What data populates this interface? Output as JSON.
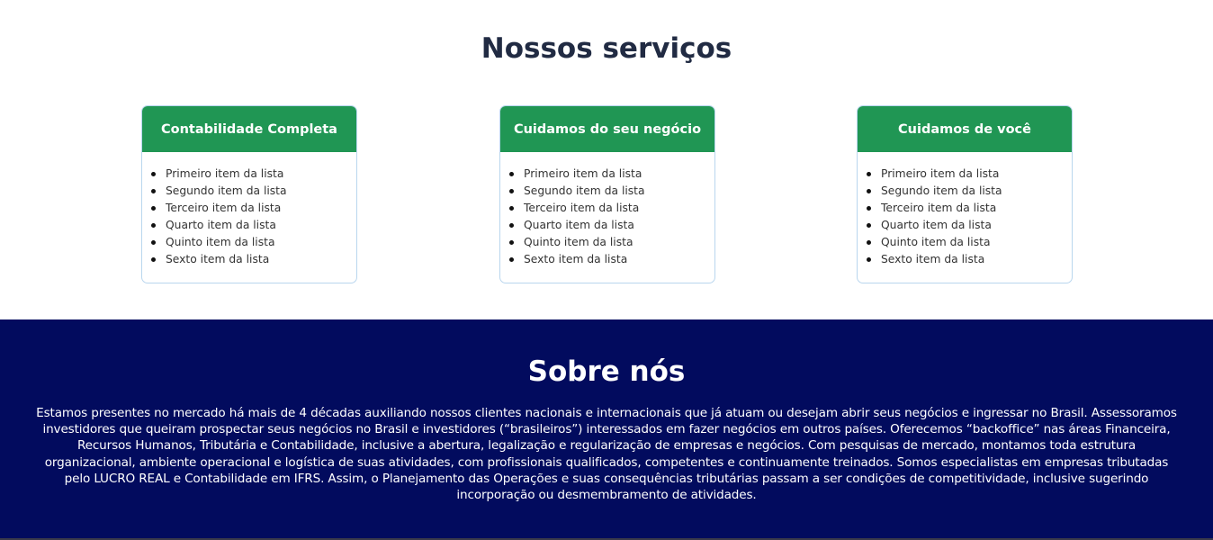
{
  "services": {
    "title": "Nossos serviços",
    "cards": [
      {
        "title": "Contabilidade Completa",
        "items": [
          "Primeiro item da lista",
          "Segundo item da lista",
          "Terceiro item da lista",
          "Quarto item da lista",
          "Quinto item da lista",
          "Sexto item da lista"
        ]
      },
      {
        "title": "Cuidamos do seu negócio",
        "items": [
          "Primeiro item da lista",
          "Segundo item da lista",
          "Terceiro item da lista",
          "Quarto item da lista",
          "Quinto item da lista",
          "Sexto item da lista"
        ]
      },
      {
        "title": "Cuidamos de você",
        "items": [
          "Primeiro item da lista",
          "Segundo item da lista",
          "Terceiro item da lista",
          "Quarto item da lista",
          "Quinto item da lista",
          "Sexto item da lista"
        ]
      }
    ]
  },
  "about": {
    "title": "Sobre nós",
    "text": "Estamos presentes no mercado há mais de 4 décadas auxiliando nossos clientes nacionais e internacionais que já atuam ou desejam abrir seus negócios e ingressar no Brasil. Assessoramos investidores que queiram prospectar seus negócios no Brasil e investidores (“brasileiros”) interessados em fazer negócios em outros países. Oferecemos “backoffice” nas áreas Financeira, Recursos Humanos, Tributária e Contabilidade, inclusive a abertura, legalização e regularização de empresas e negócios. Com pesquisas de mercado, montamos toda estrutura organizacional, ambiente operacional e logística de suas atividades, com profissionais qualificados, competentes e continuamente treinados. Somos especialistas em empresas tributadas pelo LUCRO REAL e Contabilidade em IFRS. Assim, o Planejamento das Operações e suas consequências tributárias passam a ser condições de competitividade, inclusive sugerindo incorporação ou desmembramento de atividades."
  },
  "colors": {
    "card_header": "#209654",
    "about_background": "#020b5e",
    "heading": "#212b43"
  }
}
